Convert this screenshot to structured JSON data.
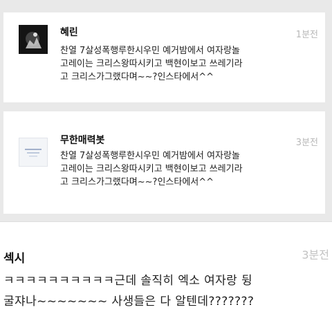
{
  "posts": [
    {
      "author": "혜린",
      "time": "1분전",
      "lines": [
        "찬열 7살성폭행루한시우민 예거밤에서 여자랑놀",
        "고레이는 크리스왕따시키고 백현이보고 쓰레기라",
        "고 크리스가그랬다며~~?인스타에서^^"
      ]
    },
    {
      "author": "무한매력봇",
      "time": "3분전",
      "lines": [
        "찬열 7살성폭행루한시우민 예거밤에서 여자랑놀",
        "고레이는 크리스왕따시키고 백현이보고 쓰레기라",
        "고 크리스가그랬다며~~?인스타에서^^"
      ]
    },
    {
      "author": "섹시",
      "time": "3분전",
      "lines": [
        "ㅋㅋㅋㅋㅋㅋㅋㅋㅋㅋ근데 솔직히 엑소 여자랑 뒹",
        "굴쟈나~~~~~~~ 사생들은 다 알텐데???????"
      ]
    }
  ]
}
